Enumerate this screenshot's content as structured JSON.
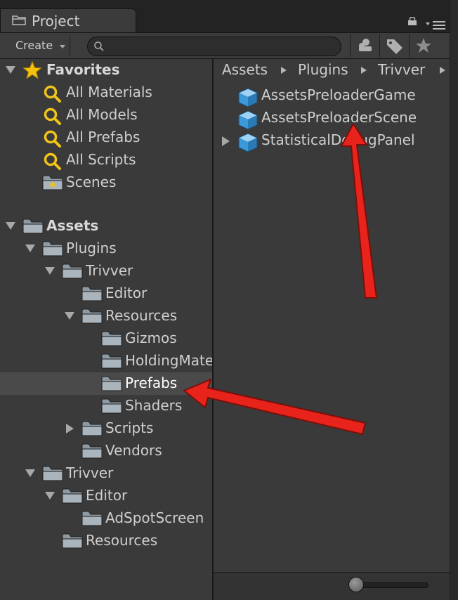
{
  "tab": {
    "title": "Project"
  },
  "toolbar": {
    "create_label": "Create",
    "search_placeholder": ""
  },
  "tree": {
    "favorites": {
      "label": "Favorites",
      "items": [
        "All Materials",
        "All Models",
        "All Prefabs",
        "All Scripts",
        "Scenes"
      ]
    },
    "assets": {
      "label": "Assets",
      "plugins": "Plugins",
      "plugins_trivver": "Trivver",
      "plugins_trivver_editor": "Editor",
      "plugins_trivver_resources": "Resources",
      "gizmos": "Gizmos",
      "holding": "HoldingMate",
      "prefabs": "Prefabs",
      "shaders": "Shaders",
      "scripts": "Scripts",
      "vendors": "Vendors",
      "trivver": "Trivver",
      "trivver_editor": "Editor",
      "adspot": "AdSpotScreen",
      "trivver_resources": "Resources"
    }
  },
  "breadcrumb": [
    "Assets",
    "Plugins",
    "Trivver"
  ],
  "assets_list": [
    "AssetsPreloaderGame",
    "AssetsPreloaderScene",
    "StatisticalDebugPanel"
  ],
  "colors": {
    "arrow": "#e8231b",
    "favorite_star": "#f4c20d",
    "search_icon": "#f0c419",
    "prefab_cube": "#3b9ad9"
  }
}
